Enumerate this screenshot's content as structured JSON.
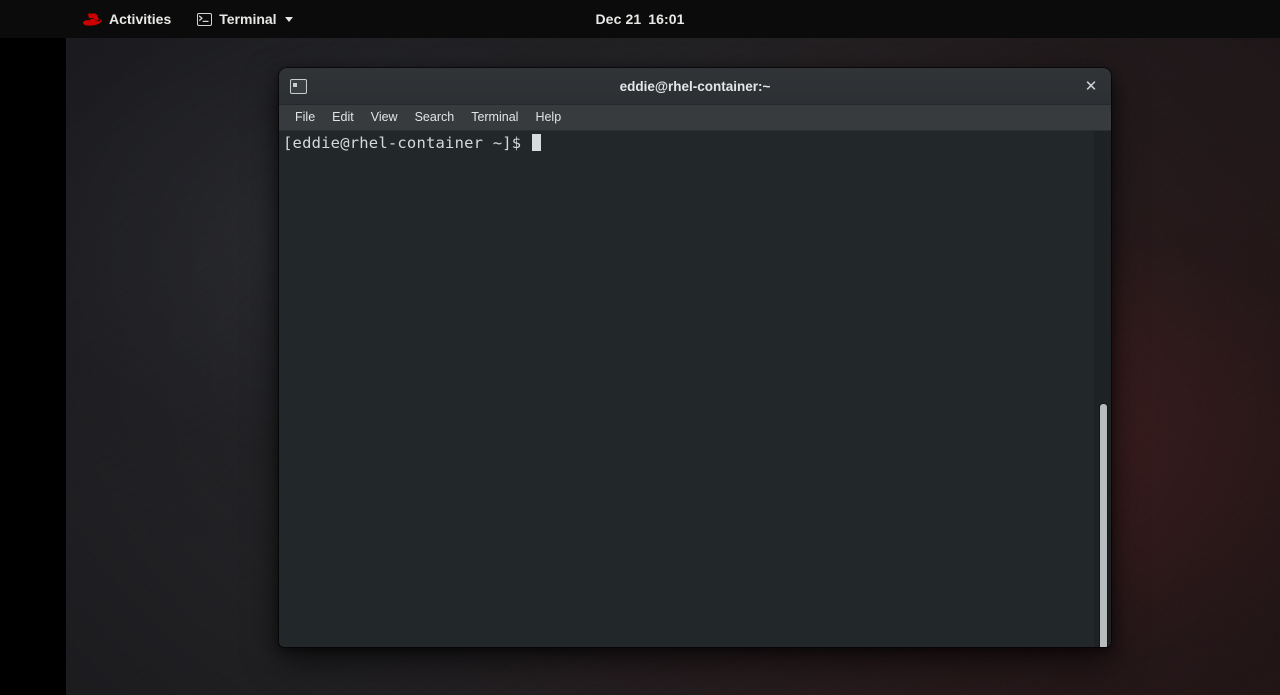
{
  "topbar": {
    "activities_label": "Activities",
    "app_menu_label": "Terminal",
    "clock_date": "Dec 21",
    "clock_time": "16:01",
    "redhat_icon": "redhat-logo-icon",
    "terminal_icon": "terminal-icon",
    "caret_icon": "chevron-down-icon",
    "background_color": "#0b0b0b",
    "logo_color": "#cc0000"
  },
  "window": {
    "title": "eddie@rhel-container:~",
    "titlebar_icon": "terminal-icon",
    "close_label": "✕",
    "titlebar_color": "#2e3235",
    "menubar_color": "#373b3e",
    "menu_items": [
      {
        "label": "File"
      },
      {
        "label": "Edit"
      },
      {
        "label": "View"
      },
      {
        "label": "Search"
      },
      {
        "label": "Terminal"
      },
      {
        "label": "Help"
      }
    ]
  },
  "terminal": {
    "background_color": "#22272a",
    "foreground_color": "#d6d9da",
    "prompt_line": "[eddie@rhel-container ~]$ ",
    "cursor": "block-cursor",
    "scrollbar": "vertical-scrollbar"
  },
  "desktop": {
    "wallpaper": "dark-red-gradient-wallpaper"
  }
}
